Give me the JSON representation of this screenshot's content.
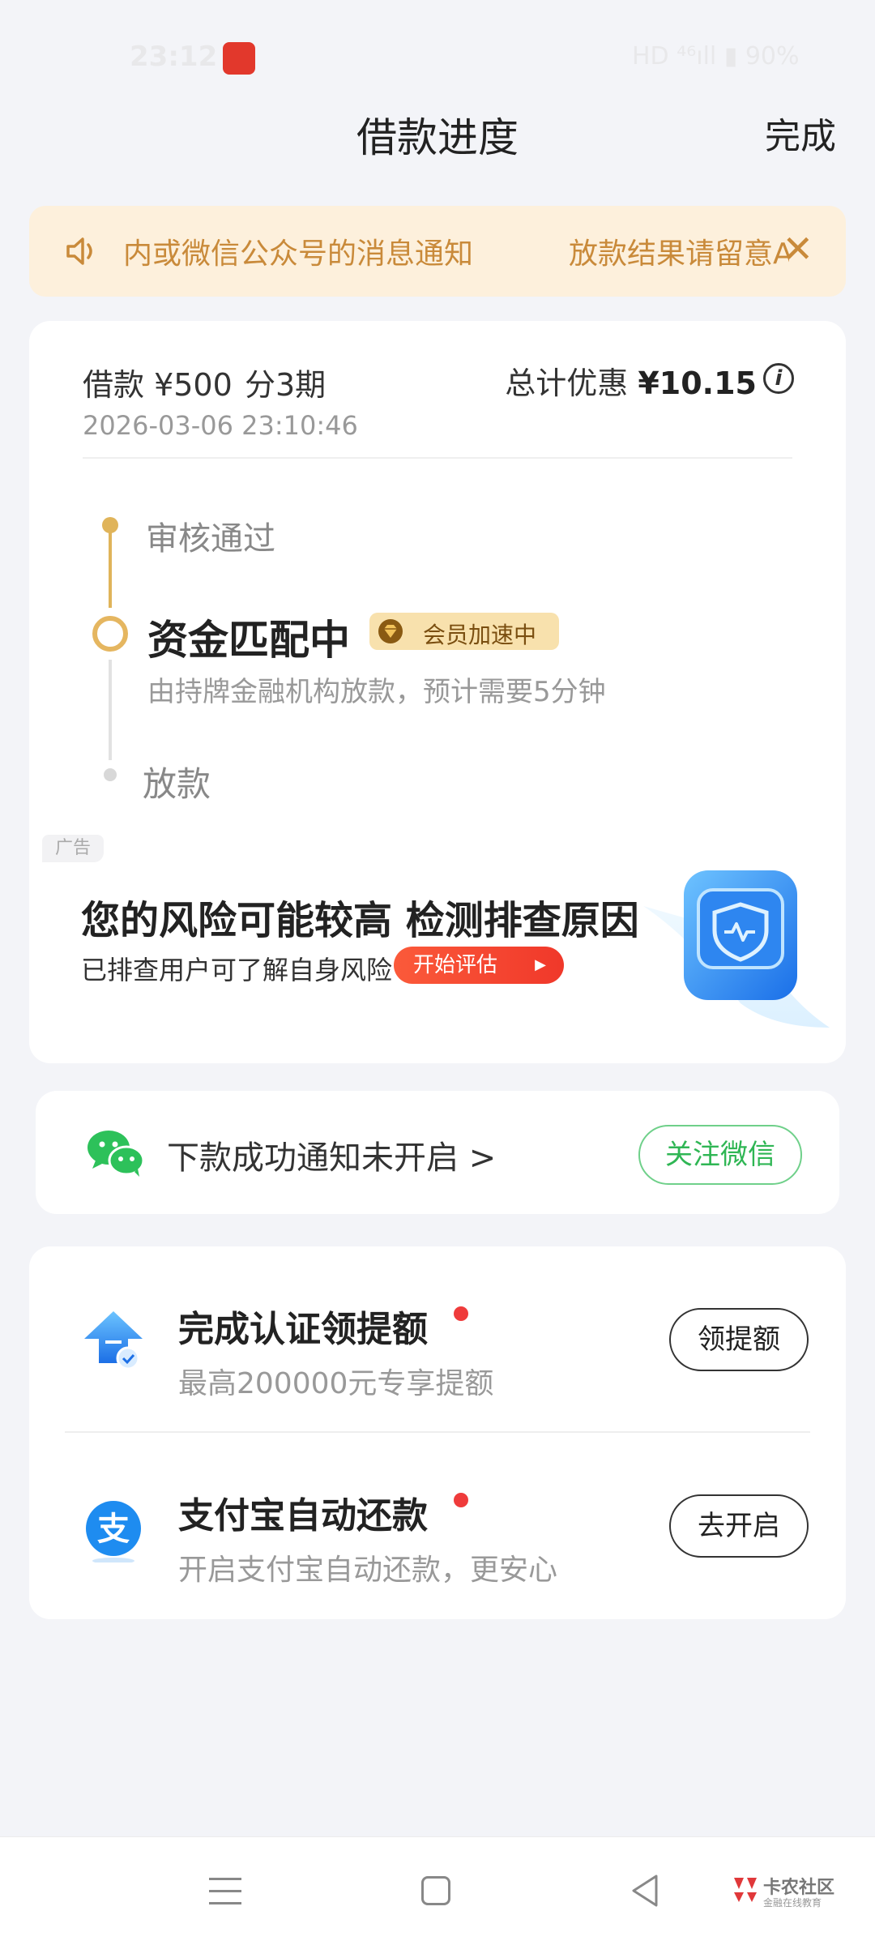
{
  "status_bar": {
    "time": "23:12",
    "right": "HD ⁴⁶ıll ▮ 90%"
  },
  "header": {
    "title": "借款进度",
    "done_label": "完成"
  },
  "notice": {
    "text": "内或微信公众号的消息通知",
    "text_tail": "放款结果请留意A"
  },
  "loan": {
    "amount": "借款 ¥500",
    "term": "分3期",
    "discount_label": "总计优惠 ",
    "discount_value": "¥10.15",
    "datetime": "2026-03-06 23:10:46"
  },
  "timeline": {
    "steps": [
      {
        "label": "审核通过"
      },
      {
        "label": "资金匹配中",
        "badge": "会员加速中",
        "desc": "由持牌金融机构放款，预计需要5分钟"
      },
      {
        "label": "放款"
      }
    ]
  },
  "ad": {
    "tag": "广告",
    "title": "您的风险可能较高 检测排查原因",
    "subtitle": "已排查用户可了解自身风险",
    "button": "开始评估"
  },
  "wechat": {
    "text": "下款成功通知未开启 >",
    "button": "关注微信"
  },
  "tasks": [
    {
      "title": "完成认证领提额",
      "desc": "最高200000元专享提额",
      "button": "领提额",
      "icon": "upgrade-arrow-icon"
    },
    {
      "title": "支付宝自动还款",
      "desc": "开启支付宝自动还款，更安心",
      "button": "去开启",
      "icon": "alipay-icon"
    }
  ],
  "watermark": {
    "text": "卡农社区",
    "sub": "金融在线教育"
  },
  "colors": {
    "accent_gold": "#e0b45a",
    "wechat_green": "#2fb654",
    "alert_red": "#ef3b3b",
    "notice_bg": "#fdf0dc"
  }
}
